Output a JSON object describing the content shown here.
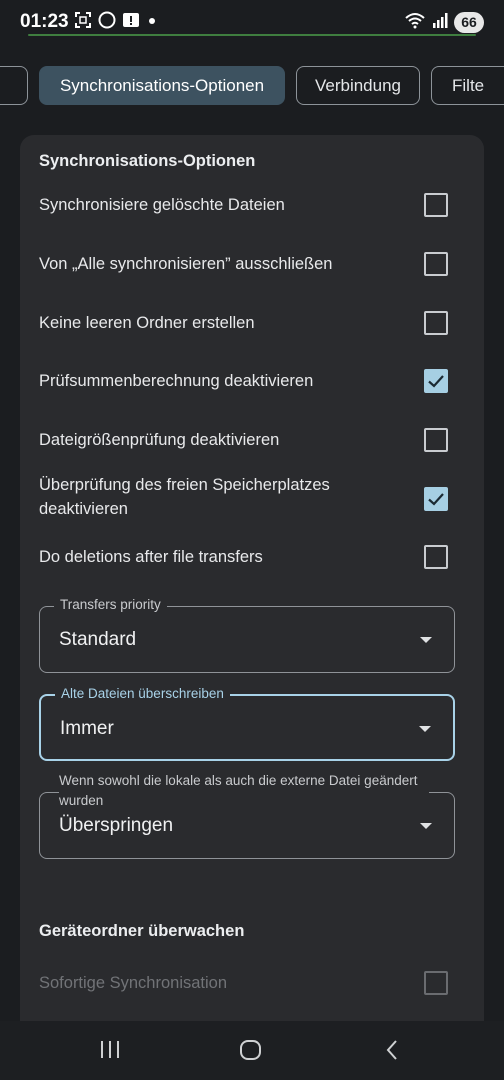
{
  "status_bar": {
    "time": "01:23",
    "battery": "66",
    "icons_left": [
      "screenshot-icon",
      "circle-icon",
      "alert-icon",
      "dot-icon"
    ],
    "icons_right": [
      "wifi-icon",
      "signal-icon",
      "battery-icon"
    ]
  },
  "tabs": [
    {
      "label": "",
      "active": false
    },
    {
      "label": "Synchronisations-Optionen",
      "active": true
    },
    {
      "label": "Verbindung",
      "active": false
    },
    {
      "label": "Filte",
      "active": false
    }
  ],
  "sync_options": {
    "title": "Synchronisations-Optionen",
    "options": [
      {
        "label": "Synchronisiere gelöschte Dateien",
        "checked": false
      },
      {
        "label": "Von „Alle synchronisieren” ausschließen",
        "checked": false
      },
      {
        "label": "Keine leeren Ordner erstellen",
        "checked": false
      },
      {
        "label": "Prüfsummenberechnung deaktivieren",
        "checked": true
      },
      {
        "label": "Dateigrößenprüfung deaktivieren",
        "checked": false
      },
      {
        "label_line1": "Überprüfung des freien Speicherplatzes",
        "label_line2": "deaktivieren",
        "checked": true
      },
      {
        "label": "Do deletions after file transfers",
        "checked": false
      }
    ],
    "transfers_priority": {
      "label": "Transfers priority",
      "value": "Standard"
    },
    "overwrite_old": {
      "label": "Alte Dateien überschreiben",
      "value": "Immer"
    },
    "both_changed": {
      "label": "Wenn sowohl die lokale als auch die externe Datei geändert wurden",
      "value": "Überspringen"
    }
  },
  "watch_folders": {
    "title": "Geräteordner überwachen",
    "instant_sync": {
      "label": "Sofortige Synchronisation",
      "checked": false,
      "disabled": true
    }
  },
  "nav": {
    "buttons": [
      "recent-apps-icon",
      "home-icon",
      "back-icon"
    ]
  },
  "colors": {
    "accent": "#a6cfe3",
    "active_tab": "#3d5260",
    "card": "#2a2b2e",
    "background": "#1b1d20"
  }
}
